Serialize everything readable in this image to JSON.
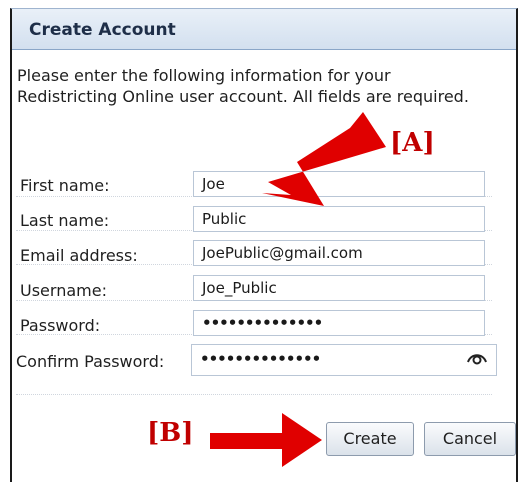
{
  "dialog": {
    "title": "Create Account",
    "instructions": "Please enter the following information for your Redistricting Online user account. All fields are required."
  },
  "fields": [
    {
      "label": "First name:",
      "value": "Joe"
    },
    {
      "label": "Last name:",
      "value": "Public"
    },
    {
      "label": "Email address:",
      "value": "JoePublic@gmail.com"
    },
    {
      "label": "Username:",
      "value": "Joe_Public"
    },
    {
      "label": "Password:",
      "value": "••••••••••••••"
    },
    {
      "label": "Confirm Password:",
      "value": "••••••••••••••",
      "icon": "eye-icon"
    }
  ],
  "buttons": {
    "create": "Create",
    "cancel": "Cancel"
  },
  "annotations": {
    "a": "[A]",
    "b": "[B]",
    "color": "#e00000"
  }
}
